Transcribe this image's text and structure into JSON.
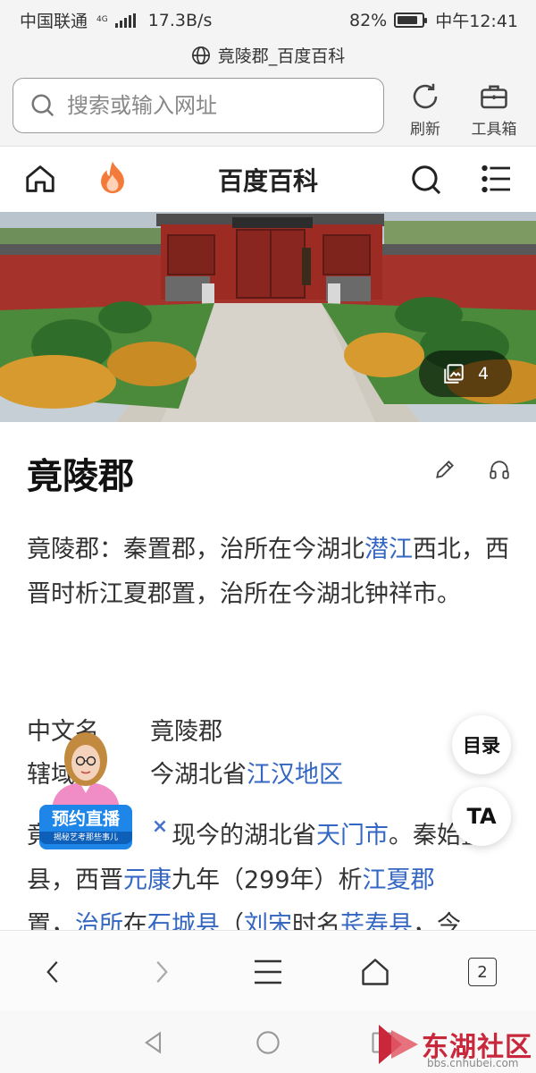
{
  "status_bar": {
    "carrier": "中国联通",
    "network": "4G",
    "speed": "17.3B/s",
    "battery_percent": "82%",
    "battery_level": 0.82,
    "time": "中午12:41"
  },
  "browser": {
    "page_title": "竟陵郡_百度百科",
    "search_placeholder": "搜索或输入网址",
    "refresh_label": "刷新",
    "toolbox_label": "工具箱"
  },
  "baike_header": {
    "title": "百度百科"
  },
  "hero": {
    "image_count": "4"
  },
  "article": {
    "title": "竟陵郡",
    "summary": {
      "before_link": "竟陵郡：秦置郡，治所在今湖北",
      "link1": "潜江",
      "after_link": "西北，西晋时析江夏郡置，治所在今湖北钟祥市。"
    },
    "info": [
      {
        "key": "中文名",
        "value": "竟陵郡"
      },
      {
        "key": "辖域",
        "value_prefix": "今湖北省",
        "value_link": "江汉地区"
      }
    ],
    "body": {
      "line1_a": "竟陵",
      "line1_b": "现今的湖北省",
      "line1_link": "天门市",
      "line1_c": "。秦始置",
      "line2_a": "县，西晋",
      "line2_link1": "元康",
      "line2_b": "九年（299年）析",
      "line2_link2": "江夏郡",
      "line3_a": "置，",
      "line3_link1": "治所",
      "line3_b": "在",
      "line3_link2": "石城县",
      "line3_c": "（",
      "line3_link3": "刘宋",
      "line3_d": "时名",
      "line3_link4": "苌寿县",
      "line3_e": "，今"
    }
  },
  "floating": {
    "toc_label": "目录",
    "ta_label": "TA"
  },
  "live_promo": {
    "title": "预约直播",
    "subtitle": "揭秘艺考那些事儿",
    "close": "×"
  },
  "bottom_nav": {
    "tabs_count": "2"
  },
  "watermark": {
    "brand": "东湖社区",
    "url": "bbs.cnhubei.com"
  },
  "colors": {
    "link": "#3467c1",
    "fire_orange": "#f47a3a",
    "live_blue": "#1d86e8",
    "watermark_red": "#c9273b"
  }
}
